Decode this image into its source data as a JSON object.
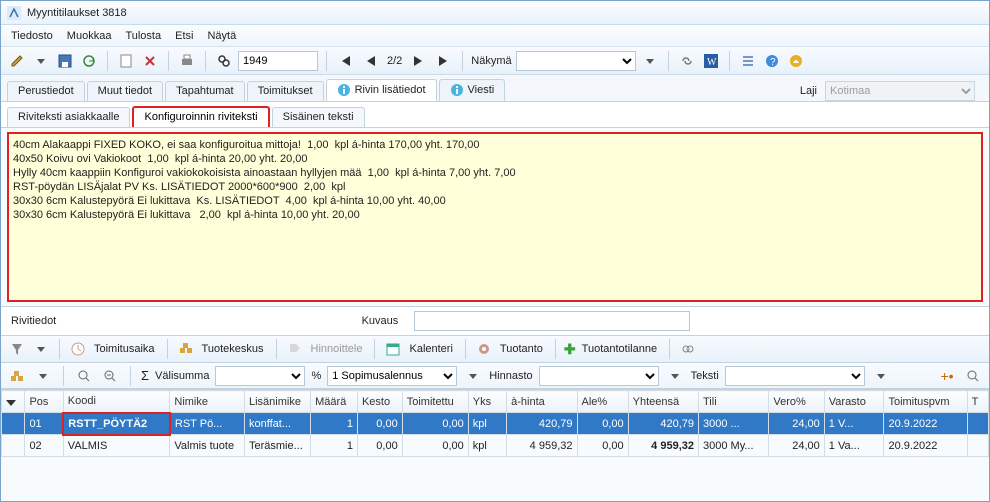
{
  "titlebar": {
    "title": "Myyntitilaukset 3818"
  },
  "menu": {
    "tiedosto": "Tiedosto",
    "muokkaa": "Muokkaa",
    "tulosta": "Tulosta",
    "etsi": "Etsi",
    "nayta": "Näytä"
  },
  "toolbar": {
    "search_value": "1949",
    "pager": "2/2",
    "nakyma_label": "Näkymä"
  },
  "tabs": {
    "perustiedot": "Perustiedot",
    "muut": "Muut tiedot",
    "tapahtumat": "Tapahtumat",
    "toimitukset": "Toimitukset",
    "lisatiedot": "Rivin lisätiedot",
    "viesti": "Viesti",
    "laji_label": "Laji",
    "laji_value": "Kotimaa"
  },
  "subtabs": {
    "asiakkaalle": "Riviteksti asiakkaalle",
    "konfig": "Konfiguroinnin riviteksti",
    "sisainen": "Sisäinen teksti"
  },
  "konfig_text": [
    "40cm Alakaappi FIXED KOKO, ei saa konfiguroitua mittoja!  1,00  kpl á-hinta 170,00 yht. 170,00",
    "40x50 Koivu ovi Vakiokoot  1,00  kpl á-hinta 20,00 yht. 20,00",
    "Hylly 40cm kaappiin Konfiguroi vakiokokoisista ainoastaan hyllyjen mää  1,00  kpl á-hinta 7,00 yht. 7,00",
    "RST-pöydän LISÄjalat PV Ks. LISÄTIEDOT 2000*600*900  2,00  kpl",
    "30x30 6cm Kalustepyörä Ei lukittava  Ks. LISÄTIEDOT  4,00  kpl á-hinta 10,00 yht. 40,00",
    "30x30 6cm Kalustepyörä Ei lukittava   2,00  kpl á-hinta 10,00 yht. 20,00"
  ],
  "rivitiedot": {
    "label": "Rivitiedot",
    "kuvaus_label": "Kuvaus",
    "kuvaus_value": ""
  },
  "row_toolbar": {
    "toimitusaika": "Toimitusaika",
    "tuotekeskus": "Tuotekeskus",
    "hinnoittele": "Hinnoittele",
    "kalenteri": "Kalenteri",
    "tuotanto": "Tuotanto",
    "tuotantotilanne": "Tuotantotilanne"
  },
  "sub_toolbar": {
    "valisumma": "Välisumma",
    "pct": "%",
    "sopimus": "1 Sopimusalennus",
    "hinnasto": "Hinnasto",
    "teksti": "Teksti"
  },
  "grid": {
    "headers": {
      "exp": "",
      "pos": "Pos",
      "koodi": "Koodi",
      "nimike": "Nimike",
      "lisa": "Lisänimike",
      "maara": "Määrä",
      "kesto": "Kesto",
      "toimitettu": "Toimitettu",
      "yks": "Yks",
      "ahinta": "à-hinta",
      "alepct": "Ale%",
      "yhteensa": "Yhteensä",
      "tili": "Tili",
      "veropct": "Vero%",
      "varasto": "Varasto",
      "toimituspvm": "Toimituspvm",
      "t": "T"
    },
    "rows": [
      {
        "pos": "01",
        "koodi": "RSTT_PÖYTÄ2",
        "nimike": "RST Pö...",
        "lisa": "konffat...",
        "maara": "1",
        "kesto": "0,00",
        "toimitettu": "0,00",
        "yks": "kpl",
        "ahinta": "420,79",
        "alepct": "0,00",
        "yhteensa": "420,79",
        "tili": "3000 ...",
        "veropct": "24,00",
        "varasto": "1 V...",
        "toimituspvm": "20.9.2022"
      },
      {
        "pos": "02",
        "koodi": "VALMIS",
        "nimike": "Valmis tuote",
        "lisa": "Teräsmie...",
        "maara": "1",
        "kesto": "0,00",
        "toimitettu": "0,00",
        "yks": "kpl",
        "ahinta": "4 959,32",
        "alepct": "0,00",
        "yhteensa": "4 959,32",
        "tili": "3000 My...",
        "veropct": "24,00",
        "varasto": "1 Va...",
        "toimituspvm": "20.9.2022"
      }
    ]
  }
}
